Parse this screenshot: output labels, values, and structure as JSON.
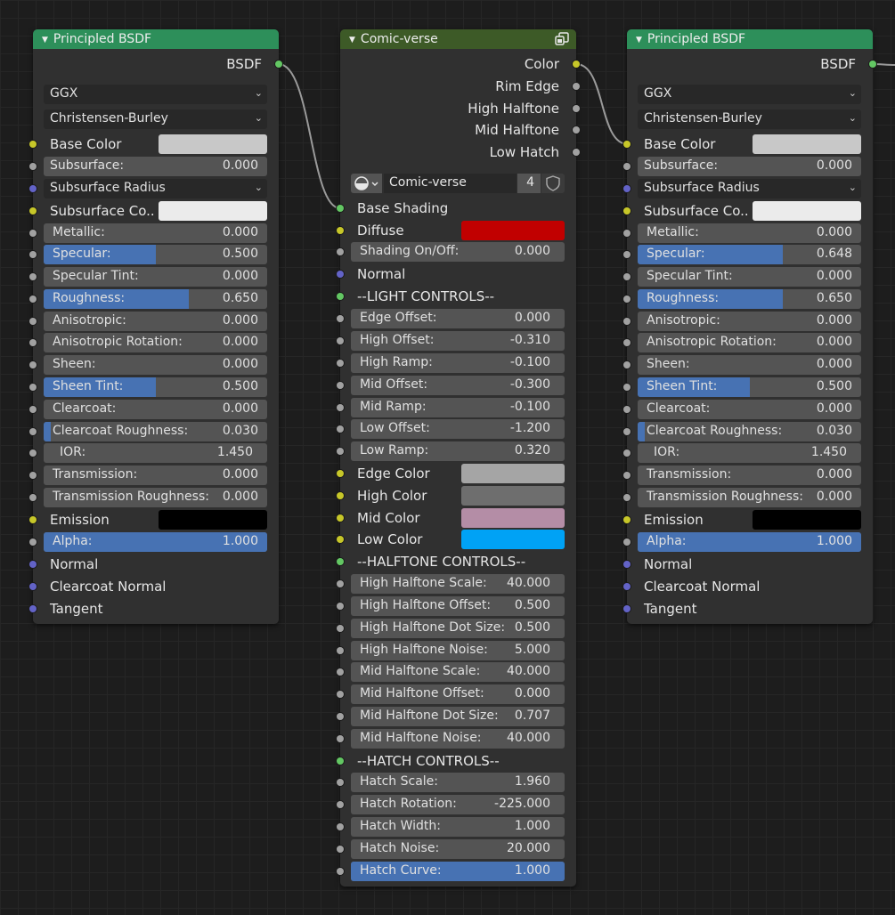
{
  "left_node": {
    "title": "Principled BSDF",
    "output": "BSDF",
    "distribution": "GGX",
    "subsurface_method": "Christensen-Burley",
    "base_color_label": "Base Color",
    "subsurface_label": "Subsurface:",
    "subsurface_value": "0.000",
    "subsurface_radius": "Subsurface Radius",
    "subsurface_color_label": "Subsurface Co..",
    "metallic_label": "Metallic:",
    "metallic_value": "0.000",
    "specular_label": "Specular:",
    "specular_value": "0.500",
    "specular_tint_label": "Specular Tint:",
    "specular_tint_value": "0.000",
    "roughness_label": "Roughness:",
    "roughness_value": "0.650",
    "anisotropic_label": "Anisotropic:",
    "anisotropic_value": "0.000",
    "aniso_rot_label": "Anisotropic Rotation:",
    "aniso_rot_value": "0.000",
    "sheen_label": "Sheen:",
    "sheen_value": "0.000",
    "sheen_tint_label": "Sheen Tint:",
    "sheen_tint_value": "0.500",
    "clearcoat_label": "Clearcoat:",
    "clearcoat_value": "0.000",
    "clearcoat_rough_label": "Clearcoat Roughness:",
    "clearcoat_rough_value": "0.030",
    "ior_label": "IOR:",
    "ior_value": "1.450",
    "transmission_label": "Transmission:",
    "transmission_value": "0.000",
    "trans_rough_label": "Transmission Roughness:",
    "trans_rough_value": "0.000",
    "emission_label": "Emission",
    "alpha_label": "Alpha:",
    "alpha_value": "1.000",
    "normal_label": "Normal",
    "clearcoat_normal_label": "Clearcoat Normal",
    "tangent_label": "Tangent",
    "colors": {
      "base": "#c8c8c8",
      "subsurface": "#ebebeb",
      "emission": "#000000"
    }
  },
  "right_node": {
    "title": "Principled BSDF",
    "output": "BSDF",
    "distribution": "GGX",
    "subsurface_method": "Christensen-Burley",
    "base_color_label": "Base Color",
    "subsurface_label": "Subsurface:",
    "subsurface_value": "0.000",
    "subsurface_radius": "Subsurface Radius",
    "subsurface_color_label": "Subsurface Co..",
    "metallic_label": "Metallic:",
    "metallic_value": "0.000",
    "specular_label": "Specular:",
    "specular_value": "0.648",
    "specular_tint_label": "Specular Tint:",
    "specular_tint_value": "0.000",
    "roughness_label": "Roughness:",
    "roughness_value": "0.650",
    "anisotropic_label": "Anisotropic:",
    "anisotropic_value": "0.000",
    "aniso_rot_label": "Anisotropic Rotation:",
    "aniso_rot_value": "0.000",
    "sheen_label": "Sheen:",
    "sheen_value": "0.000",
    "sheen_tint_label": "Sheen Tint:",
    "sheen_tint_value": "0.500",
    "clearcoat_label": "Clearcoat:",
    "clearcoat_value": "0.000",
    "clearcoat_rough_label": "Clearcoat Roughness:",
    "clearcoat_rough_value": "0.030",
    "ior_label": "IOR:",
    "ior_value": "1.450",
    "transmission_label": "Transmission:",
    "transmission_value": "0.000",
    "trans_rough_label": "Transmission Roughness:",
    "trans_rough_value": "0.000",
    "emission_label": "Emission",
    "alpha_label": "Alpha:",
    "alpha_value": "1.000",
    "normal_label": "Normal",
    "clearcoat_normal_label": "Clearcoat Normal",
    "tangent_label": "Tangent",
    "colors": {
      "base": "#c8c8c8",
      "subsurface": "#ebebeb",
      "emission": "#000000"
    }
  },
  "group_node": {
    "title": "Comic-verse",
    "outputs": [
      "Color",
      "Rim Edge",
      "High Halftone",
      "Mid Halftone",
      "Low Hatch"
    ],
    "datablock_name": "Comic-verse",
    "user_count": "4",
    "base_shading_label": "Base Shading",
    "diffuse_label": "Diffuse",
    "shading_onoff_label": "Shading On/Off:",
    "shading_onoff_value": "0.000",
    "normal_label": "Normal",
    "light_controls_label": "--LIGHT CONTROLS--",
    "edge_offset_label": "Edge Offset:",
    "edge_offset_value": "0.000",
    "high_offset_label": "High Offset:",
    "high_offset_value": "-0.310",
    "high_ramp_label": "High Ramp:",
    "high_ramp_value": "-0.100",
    "mid_offset_label": "Mid Offset:",
    "mid_offset_value": "-0.300",
    "mid_ramp_label": "Mid Ramp:",
    "mid_ramp_value": "-0.100",
    "low_offset_label": "Low Offset:",
    "low_offset_value": "-1.200",
    "low_ramp_label": "Low Ramp:",
    "low_ramp_value": "0.320",
    "edge_color_label": "Edge Color",
    "high_color_label": "High Color",
    "mid_color_label": "Mid Color",
    "low_color_label": "Low Color",
    "halftone_controls_label": "--HALFTONE CONTROLS--",
    "hh_scale_label": "High Halftone Scale:",
    "hh_scale_value": "40.000",
    "hh_offset_label": "High Halftone Offset:",
    "hh_offset_value": "0.500",
    "hh_dot_label": "High Halftone Dot Size:",
    "hh_dot_value": "0.500",
    "hh_noise_label": "High Halftone Noise:",
    "hh_noise_value": "5.000",
    "mh_scale_label": "Mid Halftone Scale:",
    "mh_scale_value": "40.000",
    "mh_offset_label": "Mid Halftone Offset:",
    "mh_offset_value": "0.000",
    "mh_dot_label": "Mid Halftone Dot Size:",
    "mh_dot_value": "0.707",
    "mh_noise_label": "Mid Halftone Noise:",
    "mh_noise_value": "40.000",
    "hatch_controls_label": "--HATCH CONTROLS--",
    "hatch_scale_label": "Hatch Scale:",
    "hatch_scale_value": "1.960",
    "hatch_rotation_label": "Hatch Rotation:",
    "hatch_rotation_value": "-225.000",
    "hatch_width_label": "Hatch Width:",
    "hatch_width_value": "1.000",
    "hatch_noise_label": "Hatch Noise:",
    "hatch_noise_value": "20.000",
    "hatch_curve_label": "Hatch Curve:",
    "hatch_curve_value": "1.000",
    "colors": {
      "diffuse": "#c10000",
      "edge": "#a5a5a5",
      "high": "#6e6e6e",
      "mid": "#b48da6",
      "low": "#00a2f5"
    }
  },
  "theme": {
    "shader_header": "#2d8f5a",
    "group_header": "#3d5a27",
    "slider_fill": "#4772b3"
  }
}
